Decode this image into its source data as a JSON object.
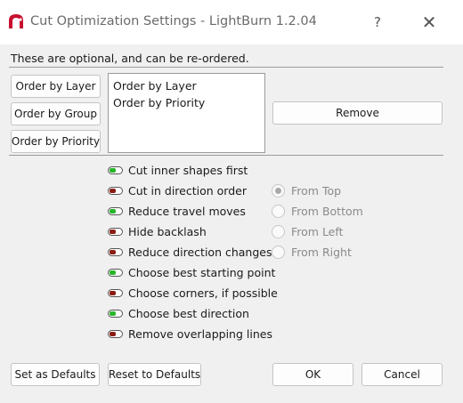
{
  "window": {
    "title": "Cut Optimization Settings - LightBurn 1.2.04",
    "help_glyph": "?",
    "close_glyph": "✕",
    "app_icon": "lightburn-logo-icon"
  },
  "hint": "These are optional, and can be re-ordered.",
  "order_buttons": {
    "layer": "Order by Layer",
    "group": "Order by Group",
    "priority": "Order by Priority"
  },
  "order_list": [
    "Order by Layer",
    "Order by Priority"
  ],
  "remove_label": "Remove",
  "options": [
    {
      "label": "Cut inner shapes first",
      "enabled": true
    },
    {
      "label": "Cut in direction order",
      "enabled": false
    },
    {
      "label": "Reduce travel moves",
      "enabled": true
    },
    {
      "label": "Hide backlash",
      "enabled": false
    },
    {
      "label": "Reduce direction changes",
      "enabled": false
    },
    {
      "label": "Choose best starting point",
      "enabled": true
    },
    {
      "label": "Choose corners, if possible",
      "enabled": false
    },
    {
      "label": "Choose best direction",
      "enabled": true
    },
    {
      "label": "Remove overlapping lines",
      "enabled": false
    }
  ],
  "direction": {
    "options": [
      "From Top",
      "From Bottom",
      "From Left",
      "From Right"
    ],
    "selected": "From Top",
    "disabled": true
  },
  "footer": {
    "set_defaults": "Set as Defaults",
    "reset_defaults": "Reset to Defaults",
    "ok": "OK",
    "cancel": "Cancel"
  },
  "colors": {
    "toggle_on": "#27b52a",
    "toggle_off": "#8b1c14",
    "logo_red": "#c8102e"
  }
}
